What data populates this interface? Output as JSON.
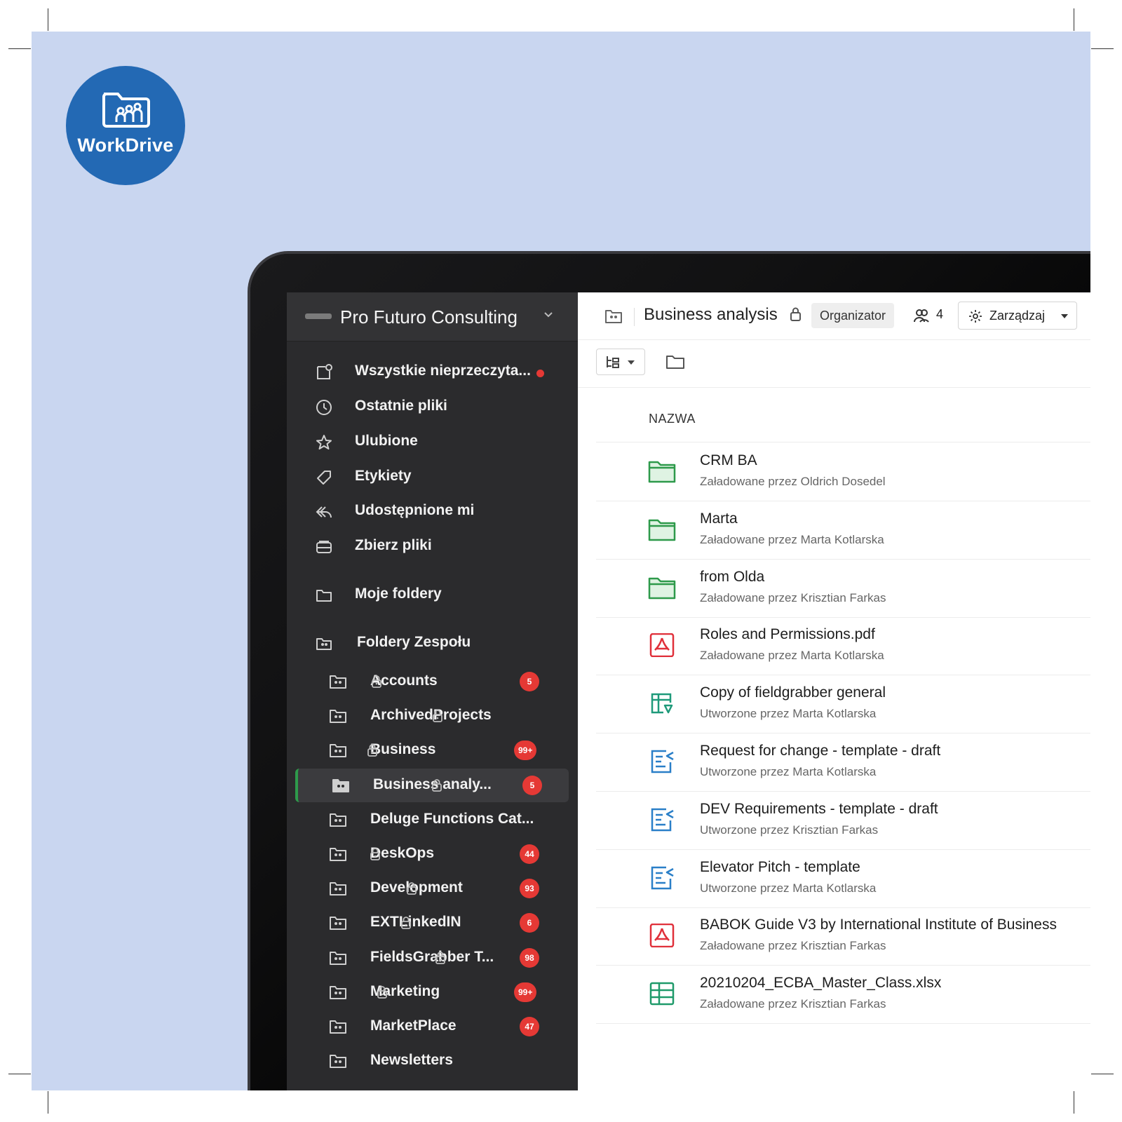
{
  "brand": {
    "logo_text": "WorkDrive",
    "accent": "#2369b4"
  },
  "sidebar": {
    "org_name": "Pro Futuro Consulting",
    "nav": [
      {
        "label": "Wszystkie nieprzeczyta...",
        "icon": "unread-icon"
      },
      {
        "label": "Ostatnie pliki",
        "icon": "clock-icon"
      },
      {
        "label": "Ulubione",
        "icon": "star-icon"
      },
      {
        "label": "Etykiety",
        "icon": "tag-icon"
      },
      {
        "label": "Udostępnione mi",
        "icon": "shared-icon"
      },
      {
        "label": "Zbierz pliki",
        "icon": "inbox-icon"
      }
    ],
    "my_folders": "Moje foldery",
    "team_folders_label": "Foldery Zespołu",
    "team_folders": [
      {
        "label": "Accounts",
        "locked": true,
        "badge": "5"
      },
      {
        "label": "ArchivedProjects",
        "locked": true,
        "badge": ""
      },
      {
        "label": "Business",
        "locked": true,
        "badge": "99+"
      },
      {
        "label": "Business analy...",
        "locked": true,
        "badge": "5",
        "active": true
      },
      {
        "label": "Deluge Functions Cat...",
        "locked": false,
        "badge": ""
      },
      {
        "label": "DeskOps",
        "locked": true,
        "badge": "44"
      },
      {
        "label": "Development",
        "locked": true,
        "badge": "93"
      },
      {
        "label": "EXTLinkedIN",
        "locked": true,
        "badge": "6"
      },
      {
        "label": "FieldsGrabber T...",
        "locked": true,
        "badge": "98"
      },
      {
        "label": "Marketing",
        "locked": true,
        "badge": "99+"
      },
      {
        "label": "MarketPlace",
        "locked": false,
        "badge": "47"
      },
      {
        "label": "Newsletters",
        "locked": false,
        "badge": ""
      }
    ]
  },
  "main": {
    "title": "Business analysis",
    "role": "Organizator",
    "members": "4",
    "manage_label": "Zarządzaj",
    "column_name": "NAZWA",
    "files": [
      {
        "name": "CRM BA",
        "sub": "Załadowane przez Oldrich Dosedel",
        "type": "folder"
      },
      {
        "name": "Marta",
        "sub": "Załadowane przez Marta Kotlarska",
        "type": "folder"
      },
      {
        "name": "from Olda",
        "sub": "Załadowane przez Krisztian Farkas",
        "type": "folder"
      },
      {
        "name": "Roles and Permissions.pdf",
        "sub": "Załadowane przez Marta Kotlarska",
        "type": "pdf"
      },
      {
        "name": "Copy of fieldgrabber general",
        "sub": "Utworzone przez Marta Kotlarska",
        "type": "sheet-form"
      },
      {
        "name": "Request for change - template - draft",
        "sub": "Utworzone przez Marta Kotlarska",
        "type": "doc"
      },
      {
        "name": "DEV Requirements - template - draft",
        "sub": "Utworzone przez Krisztian Farkas",
        "type": "doc"
      },
      {
        "name": "Elevator Pitch - template",
        "sub": "Utworzone przez Marta Kotlarska",
        "type": "doc"
      },
      {
        "name": "BABOK Guide V3 by International Institute of Business",
        "sub": "Załadowane przez Krisztian Farkas",
        "type": "pdf"
      },
      {
        "name": "20210204_ECBA_Master_Class.xlsx",
        "sub": "Załadowane przez Krisztian Farkas",
        "type": "xlsx"
      }
    ]
  },
  "colors": {
    "folder_green": "#2e9a4b",
    "pdf_red": "#e0303a",
    "doc_blue": "#2a7fc8",
    "badge_red": "#e53935"
  }
}
